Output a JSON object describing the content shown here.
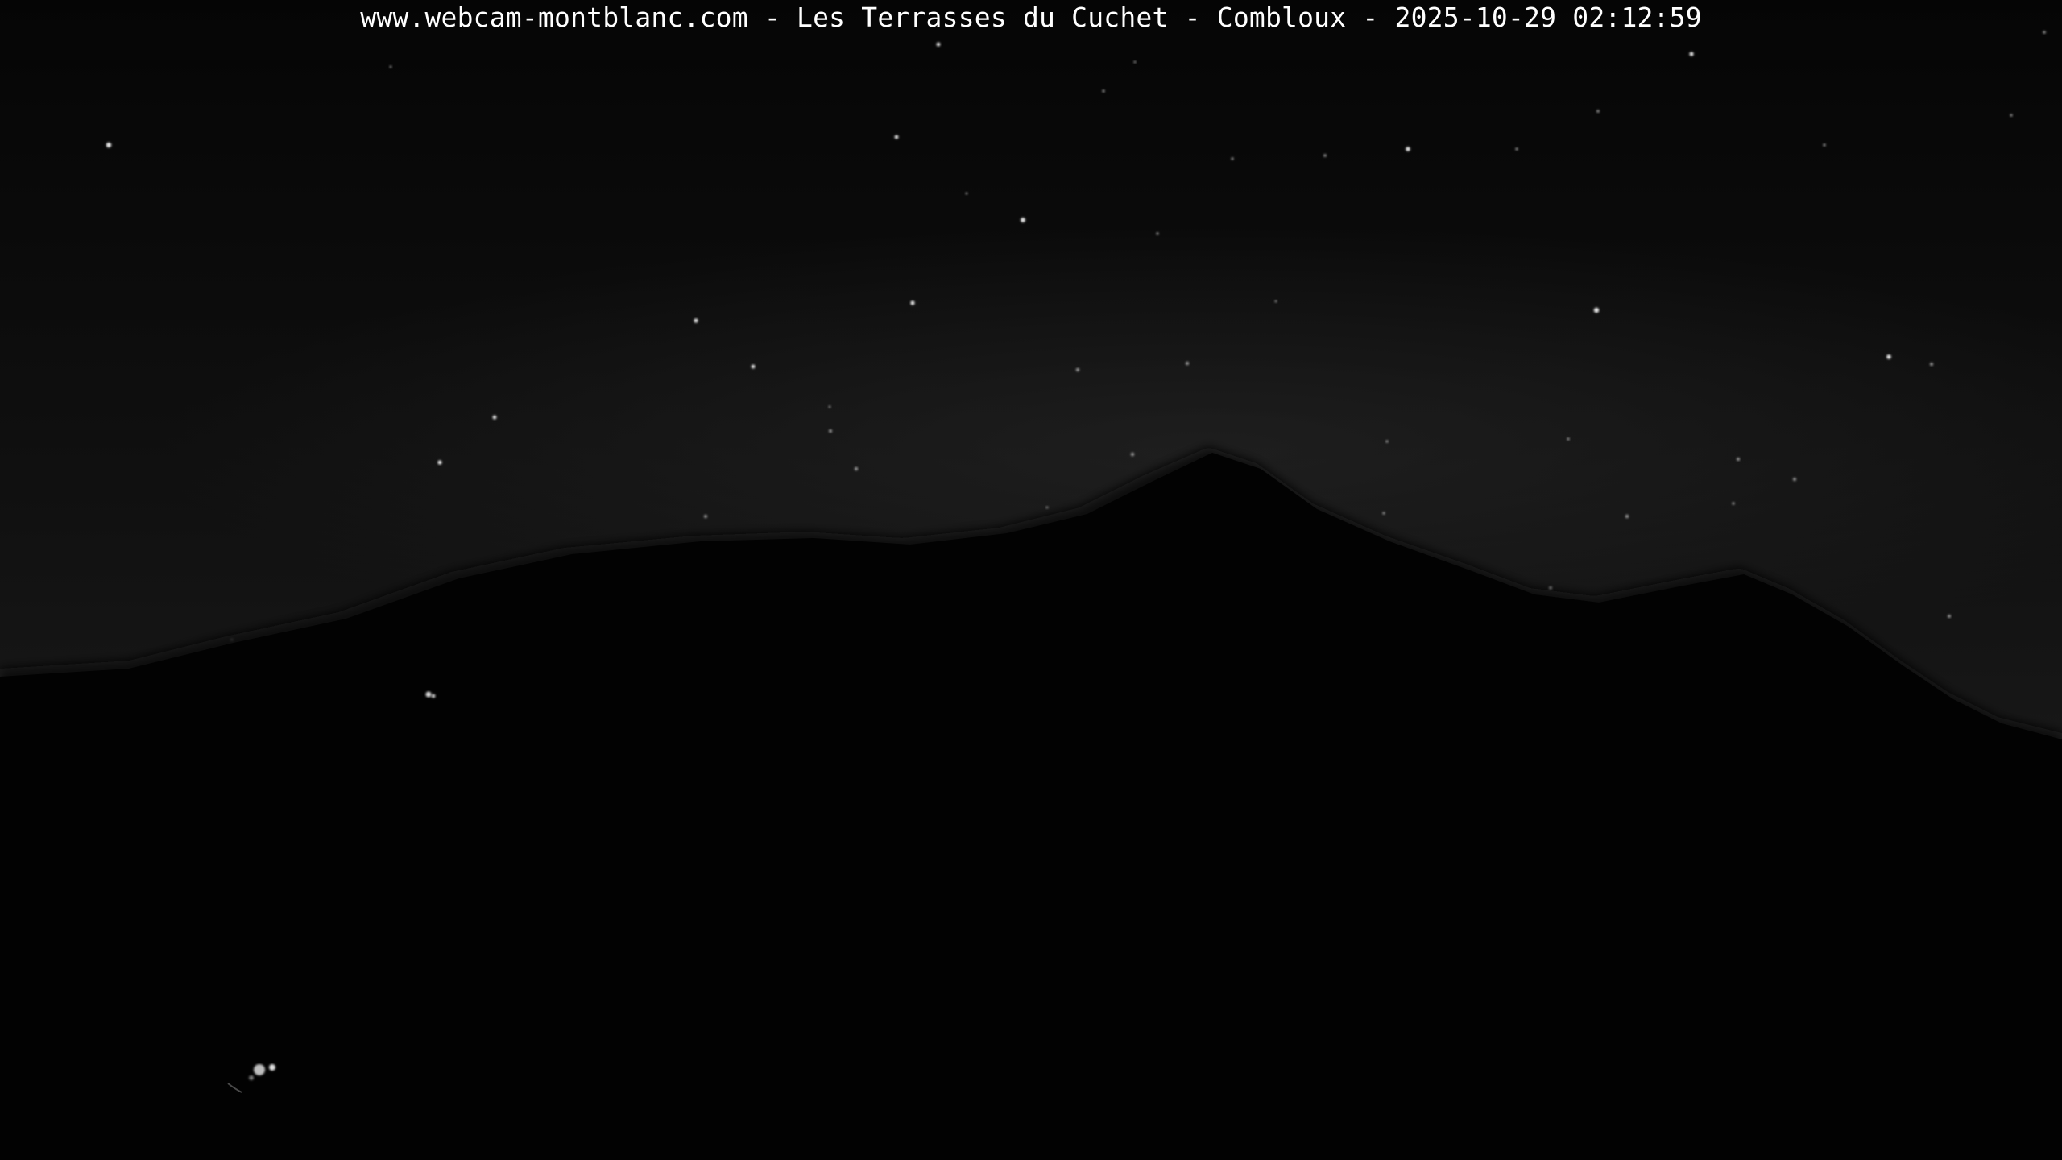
{
  "webcam": {
    "caption": "www.webcam-montblanc.com - Les Terrasses du Cuchet - Combloux - 2025-10-29 02:12:59"
  },
  "palette": {
    "sky_top": "#060606",
    "sky_horizon": "#1c1c1c",
    "haze": "#2a2a2a",
    "mountain": "#020202",
    "star": "#e8e8e8",
    "caption_text": "#ffffff"
  }
}
